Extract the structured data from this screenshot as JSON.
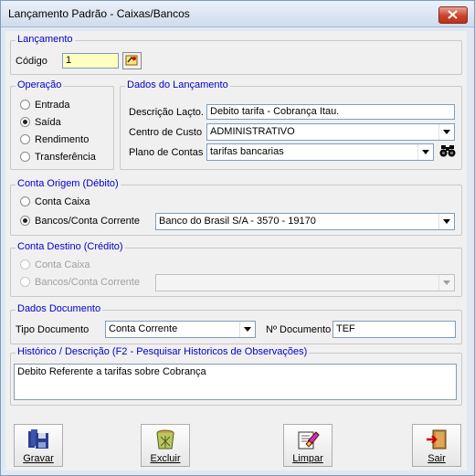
{
  "window": {
    "title": "Lançamento Padrão - Caixas/Bancos"
  },
  "lancamento": {
    "legend": "Lançamento",
    "codigo_label": "Código",
    "codigo_value": "1"
  },
  "operacao": {
    "legend": "Operação",
    "options": [
      {
        "label": "Entrada",
        "selected": false
      },
      {
        "label": "Saída",
        "selected": true
      },
      {
        "label": "Rendimento",
        "selected": false
      },
      {
        "label": "Transferência",
        "selected": false
      }
    ]
  },
  "dados_lancamento": {
    "legend": "Dados do Lançamento",
    "descricao_label": "Descrição Laçto.",
    "descricao_value": "Debito tarifa - Cobrança Itau.",
    "centro_label": "Centro de Custo",
    "centro_value": "ADMINISTRATIVO",
    "plano_label": "Plano de Contas",
    "plano_value": "tarifas bancarias"
  },
  "conta_origem": {
    "legend": "Conta Origem (Débito)",
    "caixa_label": "Conta Caixa",
    "bancos_label": "Bancos/Conta Corrente",
    "banco_value": "Banco do Brasil S/A - 3570 - 19170"
  },
  "conta_destino": {
    "legend": "Conta Destino  (Crédito)",
    "caixa_label": "Conta Caixa",
    "bancos_label": "Bancos/Conta Corrente",
    "banco_value": ""
  },
  "dados_documento": {
    "legend": "Dados Documento",
    "tipo_label": "Tipo Documento",
    "tipo_value": "Conta Corrente",
    "numero_label": "Nº Documento",
    "numero_value": "TEF"
  },
  "historico": {
    "legend": "Histórico / Descrição  (F2 - Pesquisar Historicos de Observações)",
    "text": "Debito Referente a tarifas sobre Cobrança"
  },
  "buttons": {
    "gravar": "Gravar",
    "excluir": "Excluir",
    "limpar": "Limpar",
    "sair": "Sair"
  }
}
